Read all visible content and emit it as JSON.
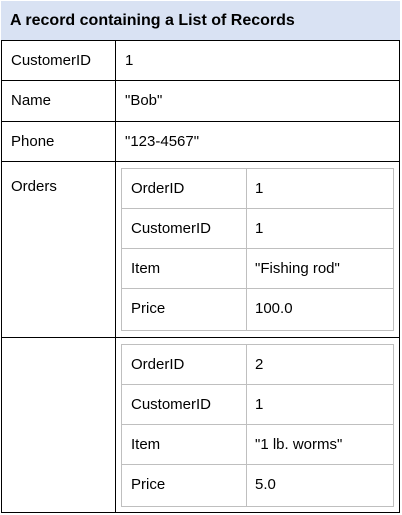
{
  "title": "A record containing a List of Records",
  "rows": [
    {
      "label": "CustomerID",
      "value": "1"
    },
    {
      "label": "Name",
      "value": "\"Bob\""
    },
    {
      "label": "Phone",
      "value": "\"123-4567\""
    }
  ],
  "orders_label": "Orders",
  "orders": [
    [
      {
        "label": "OrderID",
        "value": "1"
      },
      {
        "label": "CustomerID",
        "value": "1"
      },
      {
        "label": "Item",
        "value": "\"Fishing rod\""
      },
      {
        "label": "Price",
        "value": "100.0"
      }
    ],
    [
      {
        "label": "OrderID",
        "value": "2"
      },
      {
        "label": "CustomerID",
        "value": "1"
      },
      {
        "label": "Item",
        "value": "\"1 lb. worms\""
      },
      {
        "label": "Price",
        "value": "5.0"
      }
    ]
  ]
}
